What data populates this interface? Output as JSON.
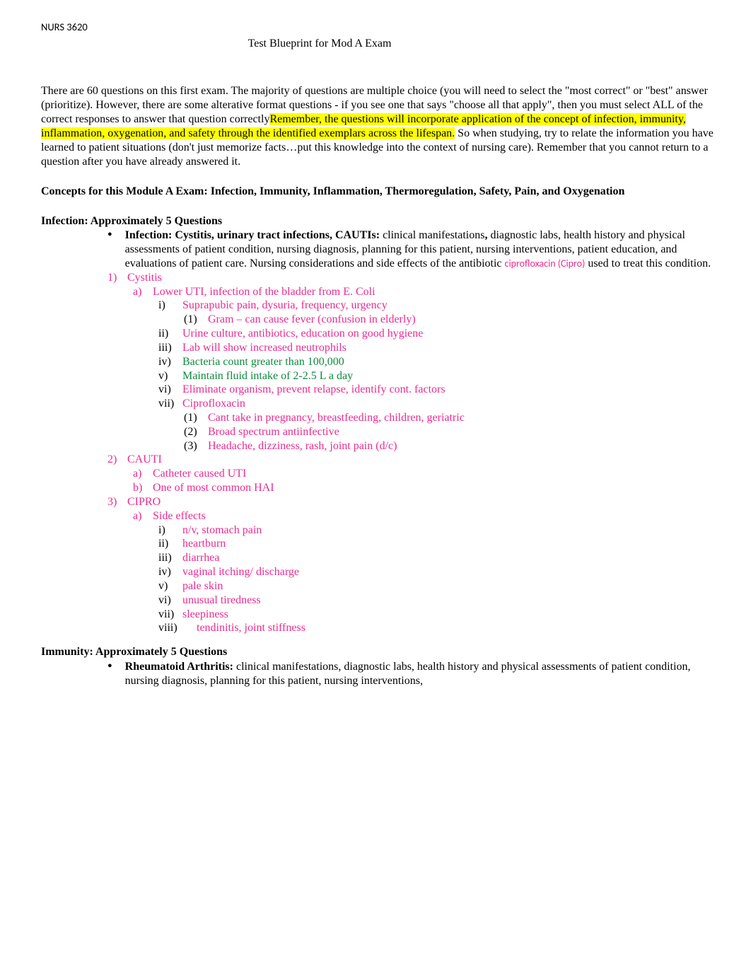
{
  "course_code": "NURS 3620",
  "title": "Test Blueprint for Mod A Exam",
  "intro": {
    "p1a": "There are 60 questions on this first exam.  The majority of questions are multiple choice (you will need to select the \"most correct\" or \"best\" answer (prioritize).  However, there are some alterative format questions - if you see one that says \"choose all that apply\", then you must select ALL of the correct responses to answer that question correctly",
    "hl": "Remember, the questions will incorporate application of the concept of infection, immunity, inflammation, oxygenation, and safety through the identified exemplars across the lifespan.",
    "p1b": "  So when studying, try to relate the information you have learned to patient situations (don't just memorize facts…put this knowledge into the context of nursing care).  Remember that you cannot return to a question after you have already answered it."
  },
  "concepts": "Concepts for this Module A Exam:  Infection, Immunity, Inflammation, Thermoregulation, Safety, Pain, and Oxygenation",
  "infection": {
    "heading": "Infection: Approximately 5 Questions",
    "bullet_bold": "Infection: Cystitis, urinary tract infections, CAUTIs: ",
    "bullet_a": "clinical manifestations",
    "bullet_comma": ", ",
    "bullet_b": "diagnostic labs, health history and physical assessments of patient condition, nursing diagnosis, planning for this patient, nursing interventions, patient education, and evaluations of patient care. Nursing considerations and side effects of the antibiotic ",
    "cipro": "ciprofloxacin (Cipro)",
    "bullet_c": " used to treat this condition.",
    "n1": "Cystitis",
    "n1a": "Lower UTI, infection of the bladder from E. Coli",
    "n1a_i": "Suprapubic pain, dysuria, frequency, urgency",
    "n1a_i_1": "Gram – can cause fever (confusion in elderly)",
    "n1a_ii": "Urine culture, antibiotics, education on good hygiene",
    "n1a_iii": "Lab will show increased neutrophils",
    "n1a_iv": "Bacteria count greater than 100,000",
    "n1a_v": "Maintain fluid intake of 2-2.5 L a day",
    "n1a_vi": "Eliminate organism, prevent relapse, identify cont. factors",
    "n1a_vii": "Ciprofloxacin",
    "n1a_vii_1": "Cant take in pregnancy, breastfeeding, children, geriatric",
    "n1a_vii_2": "Broad spectrum antiinfective",
    "n1a_vii_3": "Headache, dizziness, rash, joint pain (d/c)",
    "n2": "CAUTI",
    "n2a": "Catheter caused UTI",
    "n2b": "One of most common HAI",
    "n3": "CIPRO",
    "n3a": "Side effects",
    "n3a_i": "n/v, stomach pain",
    "n3a_ii": "heartburn",
    "n3a_iii": "diarrhea",
    "n3a_iv": "vaginal itching/ discharge",
    "n3a_v": "pale skin",
    "n3a_vi": "unusual tiredness",
    "n3a_vii": "sleepiness",
    "n3a_viii": "tendinitis, joint stiffness"
  },
  "immunity": {
    "heading": "Immunity: Approximately 5 Questions",
    "bullet_bold": "Rheumatoid Arthritis: ",
    "bullet_a": "clinical manifestations, diagnostic labs, health history and physical assessments of patient condition, nursing diagnosis, planning for this patient, nursing interventions,"
  }
}
